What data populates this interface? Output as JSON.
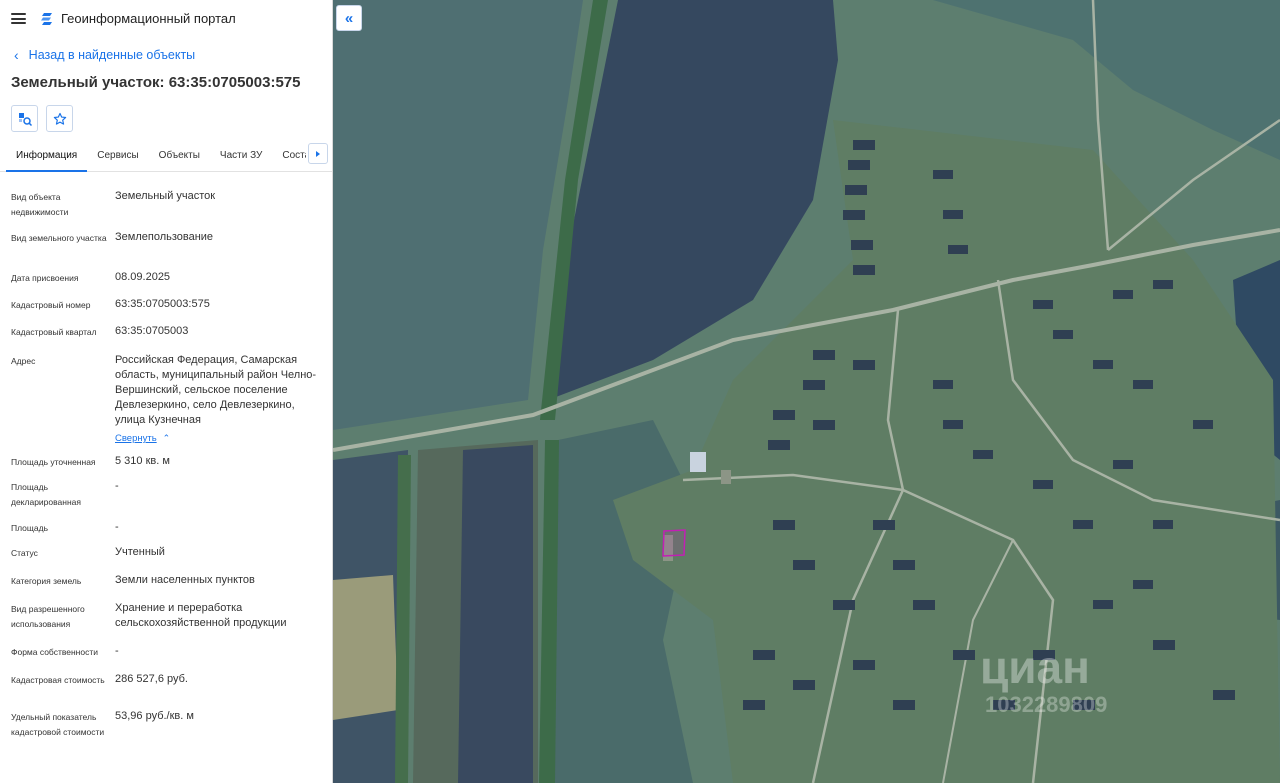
{
  "app": {
    "title": "Геоинформационный портал"
  },
  "nav": {
    "back_label": "Назад в найденные объекты"
  },
  "object": {
    "title": "Земельный участок: 63:35:0705003:575"
  },
  "tabs": [
    {
      "label": "Информация",
      "active": true
    },
    {
      "label": "Сервисы"
    },
    {
      "label": "Объекты"
    },
    {
      "label": "Части ЗУ"
    },
    {
      "label": "Состав"
    }
  ],
  "info": [
    {
      "label": "Вид объекта недвижимости",
      "value": "Земельный участок"
    },
    {
      "label": "Вид земельного участка",
      "value": "Землепользование"
    },
    {
      "label": "Дата присвоения",
      "value": "08.09.2025"
    },
    {
      "label": "Кадастровый номер",
      "value": "63:35:0705003:575"
    },
    {
      "label": "Кадастровый квартал",
      "value": "63:35:0705003"
    },
    {
      "label": "Адрес",
      "value": "Российская Федерация, Самарская область, муниципальный район Челно-Вершинский, сельское поселение Девлезеркино, село Девлезеркино, улица Кузнечная",
      "collapse_label": "Свернуть"
    },
    {
      "label": "Площадь уточненная",
      "value": "5 310 кв. м"
    },
    {
      "label": "Площадь декларированная",
      "value": "-"
    },
    {
      "label": "Площадь",
      "value": "-"
    },
    {
      "label": "Статус",
      "value": "Учтенный"
    },
    {
      "label": "Категория земель",
      "value": "Земли населенных пунктов"
    },
    {
      "label": "Вид разрешенного использования",
      "value": "Хранение и переработка сельскохозяйственной продукции"
    },
    {
      "label": "Форма собственности",
      "value": "-"
    },
    {
      "label": "Кадастровая стоимость",
      "value": "286 527,6 руб."
    },
    {
      "label": "Удельный показатель кадастровой стоимости",
      "value": "53,96 руб./кв. м"
    }
  ],
  "map": {
    "collapse_icon": "double-chevron-left-icon",
    "watermark": "циан",
    "watermark_number": "1032289809"
  },
  "colors": {
    "accent": "#1a73e8",
    "parcel_outline": "#c21fb4"
  }
}
